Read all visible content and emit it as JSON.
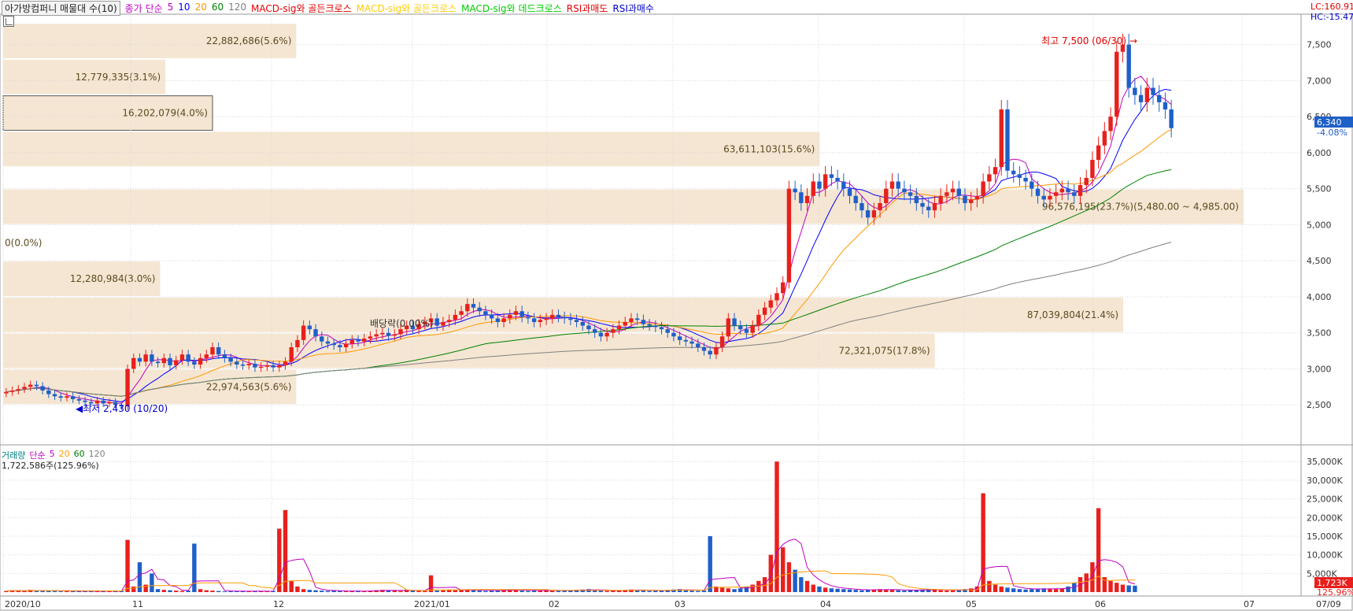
{
  "legend": {
    "title": "아가방컴퍼니 매물대 수(10)",
    "items": [
      {
        "label": "종가 단순",
        "color": "#c000c0"
      },
      {
        "label": "5",
        "color": "#c000c0"
      },
      {
        "label": "10",
        "color": "#0000ff"
      },
      {
        "label": "20",
        "color": "#ff9900"
      },
      {
        "label": "60",
        "color": "#008000"
      },
      {
        "label": "120",
        "color": "#808080"
      },
      {
        "label": "MACD-sig와 골든크로스",
        "color": "#e00000"
      },
      {
        "label": "MACD-sig와 골든크로스",
        "color": "#ffcc00"
      },
      {
        "label": "MACD-sig와 데드크로스",
        "color": "#00cc00"
      },
      {
        "label": "RSI과매도",
        "color": "#e00000"
      },
      {
        "label": "RSI과매수",
        "color": "#0000cc"
      }
    ]
  },
  "top_right": {
    "lc": "LC:160.91",
    "hc": "HC:-15.47"
  },
  "price_tag": {
    "value": "6,340",
    "pct": "-4.08%"
  },
  "vol_tag": {
    "value": "1,723K",
    "pct": "125.96%"
  },
  "annotations": {
    "high": "최고 7,500 (06/30)",
    "low": "최저 2,430 (10/20)",
    "dividend": "배당락(0.00%)",
    "zero": "0(0.0%)"
  },
  "volume_legend": {
    "items": [
      {
        "label": "거래량",
        "color": "#008080"
      },
      {
        "label": "단순",
        "color": "#c000c0"
      },
      {
        "label": "5",
        "color": "#c000c0"
      },
      {
        "label": "20",
        "color": "#ff9900"
      },
      {
        "label": "60",
        "color": "#008000"
      },
      {
        "label": "120",
        "color": "#808080"
      }
    ],
    "info": "1,722,586주(125.96%)"
  },
  "colors": {
    "up": "#e8201c",
    "down": "#1f5fc8",
    "profile": "#f5e6d3",
    "grid": "#d8d8d8"
  },
  "chart_data": {
    "type": "candlestick",
    "price_axis": {
      "ylim": [
        2000,
        7900
      ],
      "ticks": [
        "7,500",
        "7,000",
        "6,500",
        "6,000",
        "5,500",
        "5,000",
        "4,500",
        "4,000",
        "3,500",
        "3,000",
        "2,500"
      ]
    },
    "volume_axis": {
      "ylim": [
        0,
        38000
      ],
      "ticks": [
        "35,000K",
        "30,000K",
        "25,000K",
        "20,000K",
        "15,000K",
        "10,000K",
        "5,000K"
      ]
    },
    "x_axis": {
      "labels": [
        "2020/10",
        "11",
        "12",
        "2021/01",
        "02",
        "03",
        "04",
        "05",
        "06",
        "07",
        "07/09"
      ]
    },
    "volume_profile": [
      {
        "price_low": 7300,
        "price_high": 7800,
        "label": "22,882,686(5.6%)",
        "share": 5.6
      },
      {
        "price_low": 6800,
        "price_high": 7300,
        "label": "12,779,335(3.1%)",
        "share": 3.1
      },
      {
        "price_low": 6300,
        "price_high": 6800,
        "label": "16,202,079(4.0%)",
        "share": 4.0,
        "highlight": true
      },
      {
        "price_low": 5800,
        "price_high": 6300,
        "label": "63,611,103(15.6%)",
        "share": 15.6
      },
      {
        "price_low": 5000,
        "price_high": 5500,
        "label": "96,576,195(23.7%)(5,480.00 ~ 4,985.00)",
        "share": 23.7
      },
      {
        "price_low": 4500,
        "price_high": 5000,
        "label": "0(0.0%)",
        "share": 0.0
      },
      {
        "price_low": 4000,
        "price_high": 4500,
        "label": "12,280,984(3.0%)",
        "share": 3.0
      },
      {
        "price_low": 3500,
        "price_high": 4000,
        "label": "87,039,804(21.4%)",
        "share": 21.4
      },
      {
        "price_low": 3000,
        "price_high": 3500,
        "label": "72,321,075(17.8%)",
        "share": 17.8
      },
      {
        "price_low": 2500,
        "price_high": 3000,
        "label": "22,974,563(5.6%)",
        "share": 5.6
      }
    ],
    "closes": [
      2680,
      2700,
      2720,
      2750,
      2780,
      2760,
      2700,
      2650,
      2620,
      2600,
      2620,
      2580,
      2560,
      2540,
      2520,
      2560,
      2520,
      2540,
      2500,
      2480,
      3000,
      3150,
      3100,
      3200,
      3100,
      3080,
      3150,
      3050,
      3120,
      3200,
      3100,
      3060,
      3150,
      3200,
      3300,
      3200,
      3150,
      3100,
      3060,
      3050,
      3070,
      3020,
      3030,
      3050,
      3020,
      3050,
      3100,
      3300,
      3400,
      3600,
      3550,
      3450,
      3380,
      3350,
      3330,
      3300,
      3350,
      3400,
      3380,
      3420,
      3450,
      3480,
      3500,
      3460,
      3480,
      3550,
      3600,
      3550,
      3620,
      3650,
      3700,
      3600,
      3650,
      3680,
      3750,
      3800,
      3900,
      3850,
      3800,
      3750,
      3700,
      3650,
      3700,
      3750,
      3800,
      3720,
      3700,
      3650,
      3680,
      3700,
      3750,
      3720,
      3700,
      3680,
      3650,
      3600,
      3550,
      3500,
      3450,
      3500,
      3550,
      3600,
      3650,
      3700,
      3680,
      3620,
      3600,
      3580,
      3550,
      3500,
      3450,
      3400,
      3380,
      3350,
      3300,
      3250,
      3200,
      3300,
      3450,
      3700,
      3600,
      3550,
      3500,
      3600,
      3750,
      3850,
      3950,
      4050,
      4200,
      5500,
      5450,
      5300,
      5400,
      5600,
      5500,
      5700,
      5650,
      5600,
      5500,
      5400,
      5300,
      5200,
      5100,
      5200,
      5300,
      5500,
      5600,
      5500,
      5450,
      5400,
      5300,
      5250,
      5200,
      5300,
      5400,
      5450,
      5500,
      5400,
      5300,
      5350,
      5400,
      5600,
      5700,
      5800,
      6600,
      5750,
      5700,
      5650,
      5600,
      5500,
      5400,
      5350,
      5400,
      5450,
      5500,
      5450,
      5400,
      5550,
      5650,
      5900,
      6100,
      6300,
      6500,
      7400,
      7500,
      6900,
      6800,
      6700,
      6900,
      6800,
      6700,
      6600,
      6340
    ],
    "volumes_k": [
      300,
      500,
      400,
      300,
      600,
      300,
      400,
      500,
      300,
      200,
      300,
      250,
      200,
      300,
      250,
      200,
      300,
      250,
      200,
      300,
      14000,
      1500,
      8000,
      2000,
      5000,
      800,
      600,
      500,
      400,
      300,
      400,
      13000,
      800,
      500,
      400,
      300,
      200,
      200,
      300,
      250,
      200,
      300,
      250,
      200,
      300,
      17000,
      22000,
      3000,
      1500,
      800,
      600,
      500,
      400,
      300,
      400,
      300,
      200,
      300,
      250,
      300,
      400,
      500,
      600,
      500,
      400,
      300,
      600,
      500,
      400,
      300,
      4500,
      400,
      500,
      600,
      500,
      700,
      600,
      500,
      400,
      300,
      400,
      500,
      600,
      700,
      500,
      400,
      300,
      400,
      500,
      600,
      400,
      300,
      400,
      500,
      600,
      700,
      800,
      500,
      400,
      300,
      400,
      500,
      600,
      700,
      500,
      400,
      300,
      400,
      500,
      600,
      700,
      800,
      500,
      400,
      300,
      400,
      15000,
      1500,
      1200,
      1000,
      800,
      1000,
      1500,
      2000,
      3000,
      4000,
      10000,
      35000,
      12000,
      8000,
      6000,
      4000,
      3000,
      2000,
      1500,
      1200,
      1000,
      900,
      800,
      700,
      600,
      500,
      600,
      700,
      800,
      700,
      600,
      500,
      400,
      500,
      600,
      700,
      800,
      600,
      500,
      400,
      500,
      600,
      800,
      1000,
      1500,
      26500,
      3000,
      2000,
      1500,
      1200,
      1000,
      800,
      700,
      800,
      900,
      1000,
      900,
      800,
      1000,
      1500,
      2500,
      4000,
      5000,
      8000,
      22500,
      4000,
      3000,
      2500,
      2000,
      1800,
      1723
    ],
    "ma_labels": [
      "5",
      "10",
      "20",
      "60",
      "120"
    ]
  }
}
